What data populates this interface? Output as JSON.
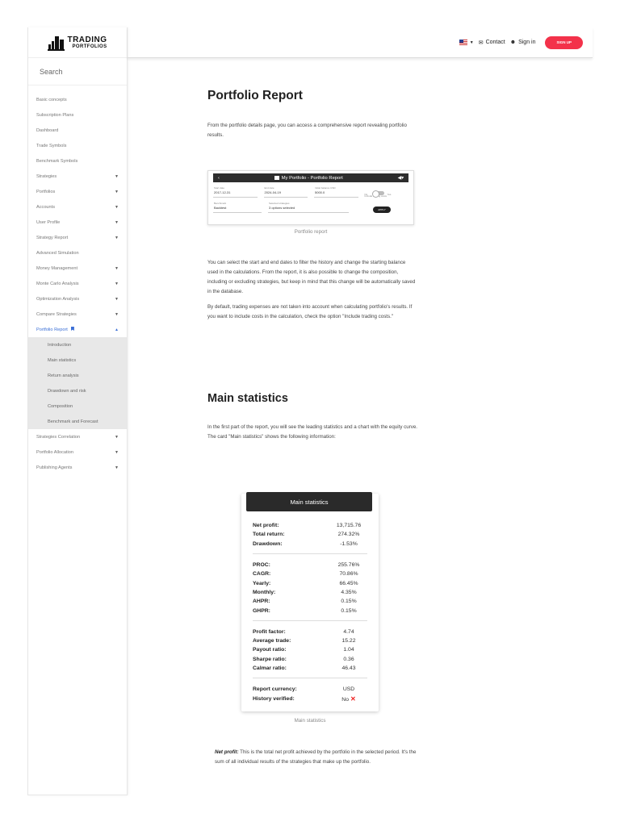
{
  "sidebar": {
    "logo_line1": "TRADING",
    "logo_line2": "PORTFOLIOS",
    "search_placeholder": "Search",
    "items": [
      {
        "label": "Basic concepts"
      },
      {
        "label": "Subscription Plans"
      },
      {
        "label": "Dashboard"
      },
      {
        "label": "Trade Symbols"
      },
      {
        "label": "Benchmark Symbols"
      },
      {
        "label": "Strategies"
      },
      {
        "label": "Portfolios"
      },
      {
        "label": "Accounts"
      },
      {
        "label": "User Profile"
      },
      {
        "label": "Strategy Report"
      },
      {
        "label": "Advanced Simulation"
      },
      {
        "label": "Money Management"
      },
      {
        "label": "Monte Carlo Analysis"
      },
      {
        "label": "Optimization Analysis"
      },
      {
        "label": "Compare Strategies"
      },
      {
        "label": "Portfolio Report"
      },
      {
        "label": "Strategies Correlation"
      },
      {
        "label": "Portfolio Allocation"
      },
      {
        "label": "Publishing Agents"
      }
    ],
    "subitems": [
      {
        "label": "Introduction"
      },
      {
        "label": "Main statistics"
      },
      {
        "label": "Return analysis"
      },
      {
        "label": "Drawdown and risk"
      },
      {
        "label": "Composition"
      },
      {
        "label": "Benchmark and Forecast"
      }
    ]
  },
  "topbar": {
    "contact": "Contact",
    "signin": "Sign in",
    "signup": "SIGN UP"
  },
  "content": {
    "title": "Portfolio Report",
    "intro": "From the portfolio details page, you can access a comprehensive report revealing portfolio results.",
    "screenshot": {
      "bar_title": "My Portfolio - Portfolio Report",
      "fields": [
        {
          "label": "Start date",
          "value": "2017-12-31"
        },
        {
          "label": "End date",
          "value": "2024-04-19"
        },
        {
          "label": "Initial balance USD",
          "value": "5000.0"
        }
      ],
      "toggle_label": "Include trading costs",
      "toggle_no": "No",
      "toggle_yes": "Yes",
      "bench_label": "Benchmark",
      "bench_value": "Backtest",
      "strat_label": "Selected strategies",
      "strat_value": "3 options selected",
      "apply": "APPLY"
    },
    "caption1": "Portfolio report",
    "para2": "You can select the start and end dates to filter the history and change the starting balance used in the calculations. From the report, it is also possible to change the composition, including or excluding strategies, but keep in mind that this change will be automatically saved in the database.",
    "para3": "By default, trading expenses are not taken into account when calculating portfolio's results. If you want to include costs in the calculation, check the option \"Include trading costs.\"",
    "heading2": "Main statistics",
    "para4": "In the first part of the report, you will see the leading statistics and a chart with the equity curve. The card \"Main statistics\" shows the following information:",
    "caption2": "Main statistics",
    "net_term": "Net profit:",
    "net_desc": " This is the total net profit achieved by the portfolio in the selected period. It's the sum of all individual results of the strategies that make up the portfolio."
  },
  "card": {
    "title": "Main statistics",
    "groups": [
      [
        [
          "Net profit:",
          "13,715.76"
        ],
        [
          "Total return:",
          "274.32%"
        ],
        [
          "Drawdown:",
          "-1.53%"
        ]
      ],
      [
        [
          "PROC:",
          "255.76%"
        ],
        [
          "CAGR:",
          "70.86%"
        ],
        [
          "Yearly:",
          "66.45%"
        ],
        [
          "Monthly:",
          "4.35%"
        ],
        [
          "AHPR:",
          "0.15%"
        ],
        [
          "GHPR:",
          "0.15%"
        ]
      ],
      [
        [
          "Profit factor:",
          "4.74"
        ],
        [
          "Average trade:",
          "15.22"
        ],
        [
          "Payout ratio:",
          "1.04"
        ],
        [
          "Sharpe ratio:",
          "0.36"
        ],
        [
          "Calmar ratio:",
          "46.43"
        ]
      ],
      [
        [
          "Report currency:",
          "USD"
        ],
        [
          "History verified:",
          "No"
        ]
      ]
    ]
  },
  "colors": {
    "accent": "#3b6fd6",
    "signup": "#f3324a",
    "dark": "#2a2a2a"
  }
}
